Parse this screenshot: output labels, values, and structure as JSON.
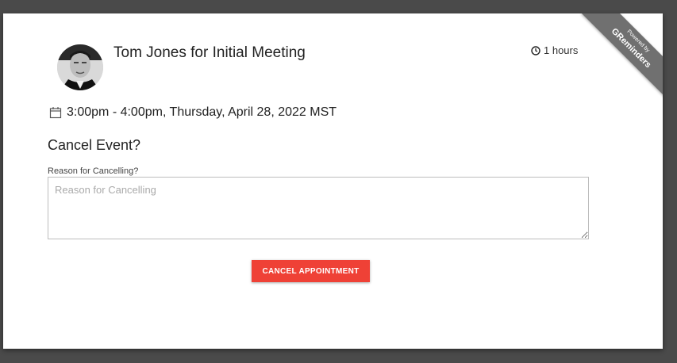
{
  "ribbon": {
    "powered_by": "Powered by",
    "brand": "GReminders"
  },
  "event": {
    "title": "Tom Jones for Initial Meeting",
    "duration": "1 hours",
    "datetime": "3:00pm - 4:00pm, Thursday, April 28, 2022 MST"
  },
  "cancel": {
    "heading": "Cancel Event?",
    "reason_label": "Reason for Cancelling?",
    "reason_placeholder": "Reason for Cancelling",
    "reason_value": "",
    "button_label": "CANCEL APPOINTMENT"
  },
  "colors": {
    "accent": "#ef4136",
    "ribbon": "#707070",
    "backdrop": "#4a4a4a"
  },
  "icons": {
    "duration": "clock-icon",
    "datetime": "calendar-icon"
  }
}
